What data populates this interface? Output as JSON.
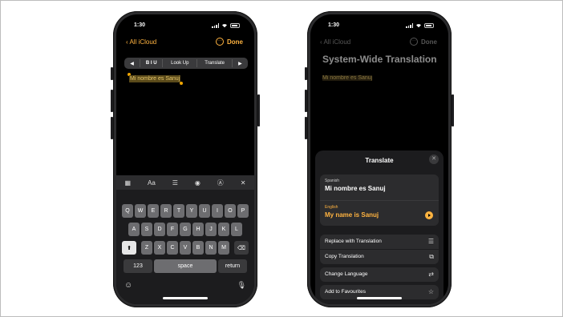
{
  "left_phone": {
    "status_time": "1:30",
    "nav": {
      "back": "All iCloud",
      "more": "···",
      "done": "Done"
    },
    "edit_menu": [
      "◀",
      "B I U",
      "Look Up",
      "Translate",
      "▶"
    ],
    "selected_text": "Mi nombre es Sanuj",
    "toolbar_icons": [
      "table-icon",
      "format-text-icon",
      "checklist-icon",
      "camera-icon",
      "markup-icon",
      "close-icon"
    ],
    "toolbar_labels": [
      "▦",
      "Aa",
      "☰",
      "◉",
      "Ⓐ",
      "✕"
    ],
    "keyboard": {
      "row1": [
        "Q",
        "W",
        "E",
        "R",
        "T",
        "Y",
        "U",
        "I",
        "O",
        "P"
      ],
      "row2": [
        "A",
        "S",
        "D",
        "F",
        "G",
        "H",
        "J",
        "K",
        "L"
      ],
      "row3": [
        "Z",
        "X",
        "C",
        "V",
        "B",
        "N",
        "M"
      ],
      "shift": "⬆",
      "backspace": "⌫",
      "numbers": "123",
      "space": "space",
      "return": "return",
      "emoji": "☺",
      "mic": "🎙"
    }
  },
  "right_phone": {
    "status_time": "1:30",
    "nav": {
      "back": "All iCloud",
      "more": "···",
      "done": "Done"
    },
    "note_title": "System-Wide Translation",
    "note_text": "Mi nombre es Sanuj",
    "sheet": {
      "title": "Translate",
      "close": "✕",
      "source_lang": "Spanish",
      "source_text": "Mi nombre es Sanuj",
      "target_lang": "English",
      "target_text": "My name is Sanuj",
      "options": [
        {
          "label": "Replace with Translation",
          "icon": "☰"
        },
        {
          "label": "Copy Translation",
          "icon": "⧉"
        },
        {
          "label": "Change Language",
          "icon": "⇄"
        },
        {
          "label": "Add to Favourites",
          "icon": "☆"
        }
      ]
    }
  },
  "colors": {
    "accent": "#ffb340",
    "highlight": "#e5c56a"
  }
}
